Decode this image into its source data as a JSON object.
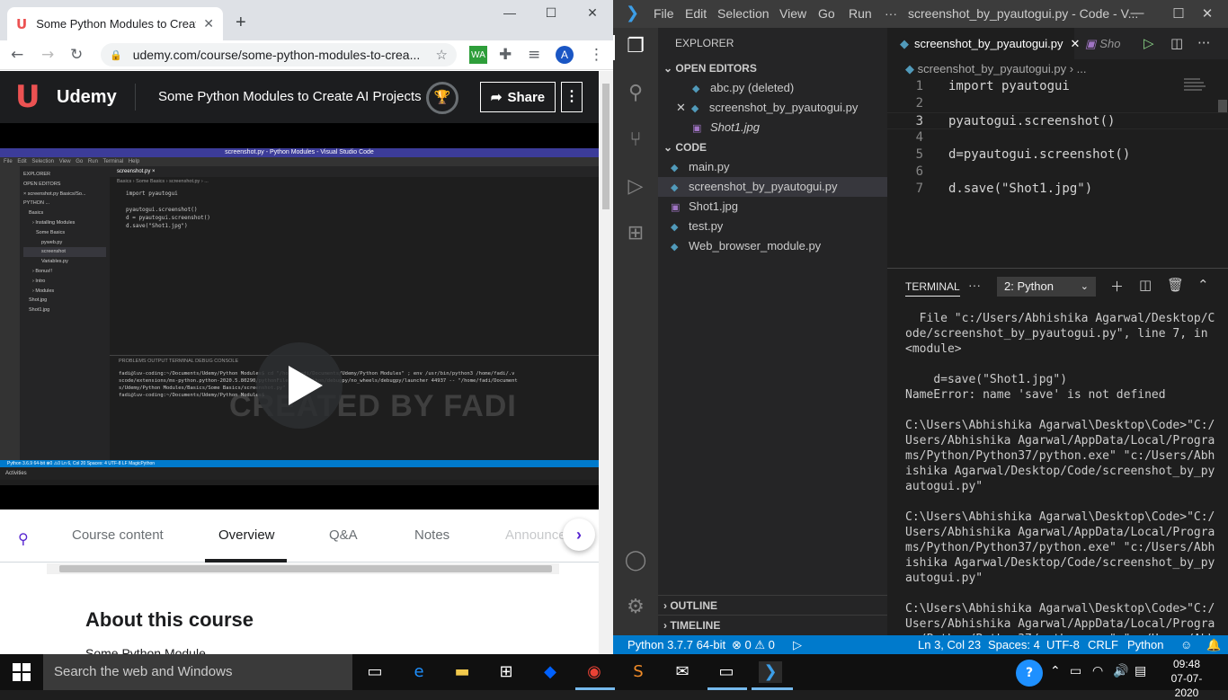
{
  "chrome": {
    "tab_title": "Some Python Modules to Create",
    "new_tab": "+",
    "url": "udemy.com/course/some-python-modules-to-crea...",
    "profile_initial": "A",
    "ext_wa": "WA",
    "window_controls": {
      "minimize": "—",
      "maximize": "☐",
      "close": "✕"
    }
  },
  "udemy": {
    "brand": "Udemy",
    "course_title": "Some Python Modules to Create AI Projects",
    "share_label": "Share",
    "more_label": "⋮",
    "video": {
      "title": "screenshot.py - Python Modules - Visual Studio Code",
      "menu": "File Edit Selection View Go Run Terminal Help",
      "explorer_lines": [
        "EXPLORER",
        "OPEN EDITORS",
        "× screenshot.py Basics/So...",
        "PYTHON ...",
        "Basics",
        "› Installing Modules",
        "Some Basics",
        "pyweb.py",
        "screenshot",
        "Variables.py",
        "› Bonus!!",
        "› Intro",
        "› Modules",
        "Shot.jpg",
        "Shot1.jpg"
      ],
      "editor_tab": "screenshot.py ×",
      "breadcrumb": "Basics › Some Basics › screenshot.py › ...",
      "code_lines": [
        "import pyautogui",
        "",
        "pyautogui.screenshot()",
        "d = pyautogui.screenshot()",
        "d.save(\"Shot1.jpg\")"
      ],
      "terminal_tabs": "PROBLEMS   OUTPUT   TERMINAL   DEBUG CONSOLE",
      "terminal_lines": [
        "fadi@luv-coding:~/Documents/Udemy/Python Modules$  cd \"/home/fadi/Documents/Udemy/Python Modules\" ; env /usr/bin/python3 /home/fadi/.v",
        "scode/extensions/ms-python.python-2020.5.80290/pythonFiles/lib/python/debugpy/no_wheels/debugpy/launcher 44937 -- \"/home/fadi/Document",
        "s/Udemy/Python Modules/Basics/Some Basics/screenshot.py\"",
        "fadi@luv-coding:~/Documents/Udemy/Python Modules$ "
      ],
      "status": "Python 3.6.9 64-bit   ⊗0 ⚠0        Ln 6, Col 20   Spaces: 4   UTF-8   LF   MagicPython",
      "taskbar": "Activities",
      "watermark": "CREATED BY FADI"
    },
    "tabs": [
      "Course content",
      "Overview",
      "Q&A",
      "Notes",
      "Announce"
    ],
    "about_heading": "About this course",
    "about_sub": "Some Python Module..."
  },
  "vscode": {
    "menu": [
      "File",
      "Edit",
      "Selection",
      "View",
      "Go",
      "Run",
      "···"
    ],
    "window_title": "screenshot_by_pyautogui.py - Code - V...",
    "explorer_title": "EXPLORER",
    "open_editors_title": "OPEN EDITORS",
    "open_editors": [
      {
        "name": "abc.py (deleted)",
        "icon": "python-icon"
      },
      {
        "name": "screenshot_by_pyautogui.py",
        "icon": "python-icon"
      },
      {
        "name": "Shot1.jpg",
        "icon": "image-icon"
      }
    ],
    "folder_title": "CODE",
    "files": [
      {
        "name": "main.py",
        "icon": "python-icon"
      },
      {
        "name": "screenshot_by_pyautogui.py",
        "icon": "python-icon"
      },
      {
        "name": "Shot1.jpg",
        "icon": "image-icon"
      },
      {
        "name": "test.py",
        "icon": "python-icon"
      },
      {
        "name": "Web_browser_module.py",
        "icon": "python-icon"
      }
    ],
    "outline_title": "OUTLINE",
    "timeline_title": "TIMELINE",
    "editor_tab_active": "screenshot_by_pyautogui.py",
    "editor_tab_preview": "Sho",
    "breadcrumb": "screenshot_by_pyautogui.py › ...",
    "code": [
      {
        "n": "1",
        "t": "import pyautogui"
      },
      {
        "n": "2",
        "t": ""
      },
      {
        "n": "3",
        "t": "pyautogui.screenshot()"
      },
      {
        "n": "4",
        "t": ""
      },
      {
        "n": "5",
        "t": "d=pyautogui.screenshot()"
      },
      {
        "n": "6",
        "t": ""
      },
      {
        "n": "7",
        "t": "d.save(\"Shot1.jpg\")"
      }
    ],
    "panel_title": "TERMINAL",
    "terminal_select": "2: Python",
    "terminal_output": "  File \"c:/Users/Abhishika Agarwal/Desktop/Code/screenshot_by_pyautogui.py\", line 7, in <module>\n\n    d=save(\"Shot1.jpg\")\nNameError: name 'save' is not defined\n\nC:\\Users\\Abhishika Agarwal\\Desktop\\Code>\"C:/Users/Abhishika Agarwal/AppData/Local/Programs/Python/Python37/python.exe\" \"c:/Users/Abhishika Agarwal/Desktop/Code/screenshot_by_pyautogui.py\"\n\nC:\\Users\\Abhishika Agarwal\\Desktop\\Code>\"C:/Users/Abhishika Agarwal/AppData/Local/Programs/Python/Python37/python.exe\" \"c:/Users/Abhishika Agarwal/Desktop/Code/screenshot_by_pyautogui.py\"\n\nC:\\Users\\Abhishika Agarwal\\Desktop\\Code>\"C:/Users/Abhishika Agarwal/AppData/Local/Programs/Python/Python37/python.exe\" \"c:/Users/Abhishika Agarwal/Desktop/Code/screenshot_by_pyautogui.py\"\n▯",
    "status": {
      "interpreter": "Python 3.7.7 64-bit",
      "problems": "⊗ 0 ⚠ 0",
      "position": "Ln 3, Col 23",
      "spaces": "Spaces: 4",
      "encoding": "UTF-8",
      "eol": "CRLF",
      "language": "Python"
    },
    "accent": "#007acc"
  },
  "taskbar": {
    "search_placeholder": "Search the web and Windows",
    "time": "09:48",
    "date": "07-07-2020"
  }
}
